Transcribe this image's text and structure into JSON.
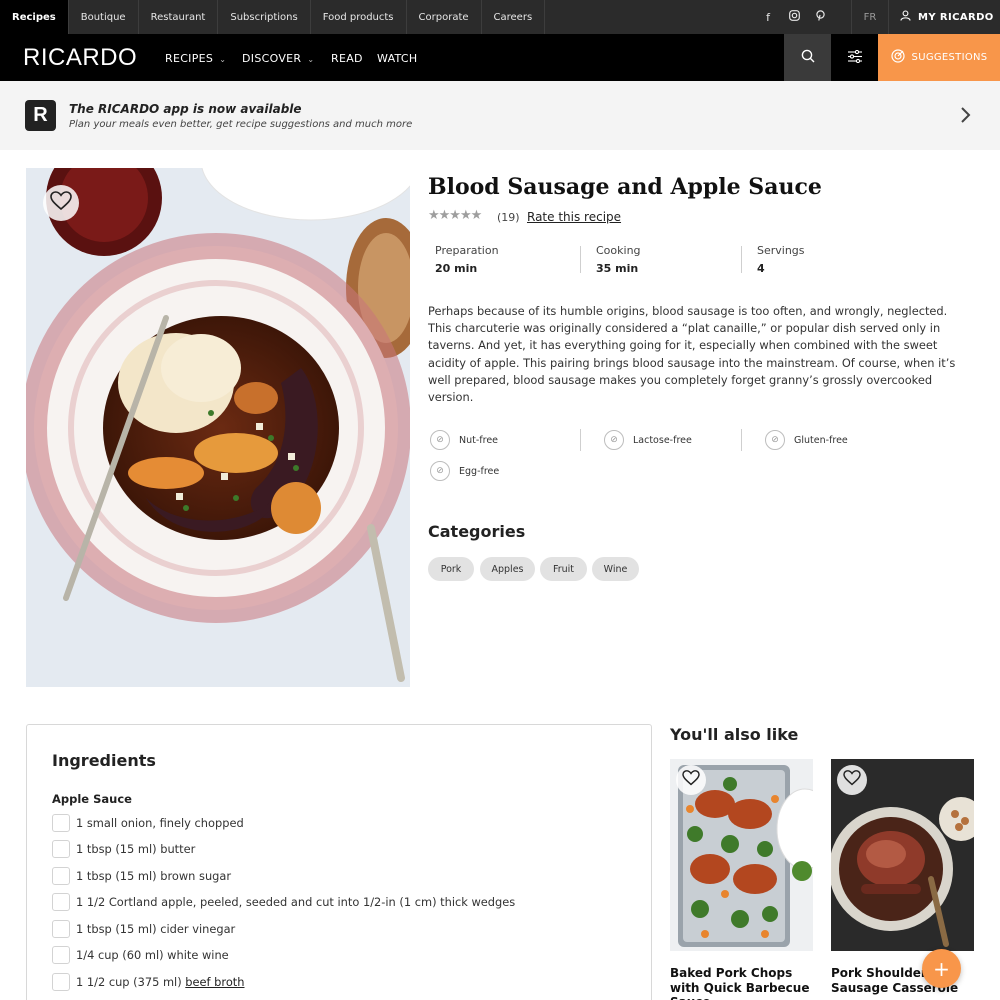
{
  "topbar": {
    "tabs": [
      "Recipes",
      "Boutique",
      "Restaurant",
      "Subscriptions",
      "Food products",
      "Corporate",
      "Careers"
    ],
    "social": [
      "facebook-icon",
      "instagram-icon",
      "pinterest-icon"
    ],
    "lang": "FR",
    "account_label": "MY RICARDO"
  },
  "nav": {
    "logo": "RICARDO",
    "items": [
      "RECIPES",
      "DISCOVER",
      "READ",
      "WATCH"
    ],
    "suggestions_label": "SUGGESTIONS",
    "accent": "#f8964a"
  },
  "banner": {
    "logo_letter": "R",
    "title": "The RICARDO app is now available",
    "subtitle": "Plan your meals even better, get recipe suggestions and much more"
  },
  "recipe": {
    "title": "Blood Sausage and Apple Sauce",
    "rating_stars": "★★★★★",
    "reviews": "(19)",
    "rate_label": "Rate this recipe",
    "times": [
      {
        "label": "Preparation",
        "value": "20 min"
      },
      {
        "label": "Cooking",
        "value": "35 min"
      },
      {
        "label": "Servings",
        "value": "4"
      }
    ],
    "description": "Perhaps because of its humble origins, blood sausage is too often, and wrongly, neglected. This charcuterie was originally considered a “plat canaille,” or popular dish served only in taverns. And yet, it has everything going for it, especially when combined with the sweet acidity of apple. This pairing brings blood sausage into the mainstream. Of course, when it’s well prepared, blood sausage makes you completely forget granny’s grossly overcooked version.",
    "diets": [
      "Nut-free",
      "Lactose-free",
      "Gluten-free",
      "Egg-free"
    ],
    "categories_heading": "Categories",
    "categories": [
      "Pork",
      "Apples",
      "Fruit",
      "Wine"
    ]
  },
  "ingredients": {
    "heading": "Ingredients",
    "section": "Apple Sauce",
    "items": [
      "1 small onion, finely chopped",
      "1 tbsp (15 ml) butter",
      "1 tbsp (15 ml) brown sugar",
      "1 1/2 Cortland apple, peeled, seeded and cut into 1/2-in (1 cm) thick wedges",
      "1 tbsp (15 ml) cider vinegar",
      "1/4 cup (60 ml) white wine"
    ],
    "last_item_prefix": "1 1/2 cup (375 ml) ",
    "last_item_link": "beef broth"
  },
  "also_like": {
    "heading": "You'll also like",
    "cards": [
      {
        "title": "Baked Pork Chops with Quick Barbecue Sauce"
      },
      {
        "title": "Pork Shoulder and Sausage Casserole"
      }
    ]
  },
  "fab_label": "+"
}
